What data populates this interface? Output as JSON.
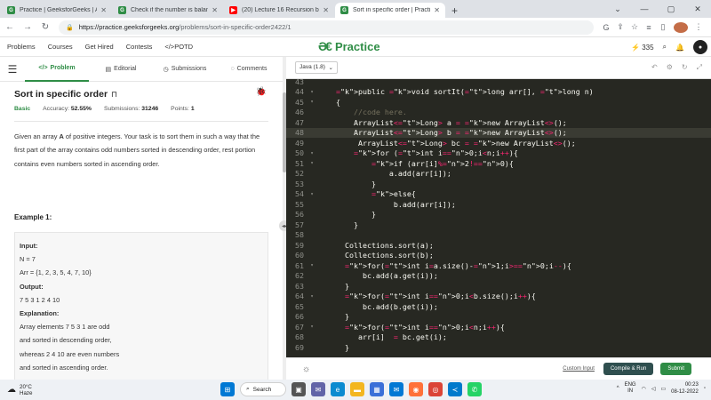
{
  "browser": {
    "tabs": [
      {
        "title": "Practice | GeeksforGeeks | A com",
        "color": "#2f8d46",
        "active": false
      },
      {
        "title": "Check if the number is balanced",
        "color": "#2f8d46",
        "active": false
      },
      {
        "title": "(20) Lecture 16 Recursion basics",
        "color": "#ff0000",
        "active": false
      },
      {
        "title": "Sort in specific order | Practice |",
        "color": "#2f8d46",
        "active": true
      }
    ],
    "new_tab": "+",
    "url_host": "https://practice.geeksforgeeks.org",
    "url_path": "/problems/sort-in-specific-order2422/1"
  },
  "header": {
    "nav": [
      "Problems",
      "Courses",
      "Get Hired",
      "Contests",
      "POTD"
    ],
    "logo_text": "Practice",
    "streak": "335"
  },
  "left_tabs": [
    "Problem",
    "Editorial",
    "Submissions",
    "Comments"
  ],
  "problem": {
    "title": "Sort in specific order",
    "difficulty": "Basic",
    "accuracy_label": "Accuracy:",
    "accuracy": "52.55%",
    "submissions_label": "Submissions:",
    "submissions": "31246",
    "points_label": "Points:",
    "points": "1",
    "desc_pre": "Given an array ",
    "desc_bold": "A",
    "desc_post": " of positive integers. Your task is to sort them in such a way that the first part of the array contains odd numbers sorted in descending order, rest portion contains even numbers sorted in ascending order.",
    "example_title": "Example 1:",
    "input_label": "Input:",
    "input_n": "N = 7",
    "input_arr": "Arr = {1, 2, 3, 5, 4, 7, 10}",
    "output_label": "Output:",
    "output_val": "7 5 3 1 2 4 10",
    "explanation_label": "Explanation:",
    "explanation_lines": [
      "Array elements 7 5 3 1 are odd",
      "and sorted in descending order,",
      "whereas 2 4 10 are even numbers",
      "and sorted in ascending order."
    ]
  },
  "editor": {
    "language": "Java (1.8)",
    "custom_input": "Custom Input",
    "compile_run": "Compile & Run",
    "submit": "Submit",
    "first_line": 43,
    "highlight_line": 48,
    "lines": [
      "",
      "    public void sortIt(long arr[], long n)",
      "    {",
      "        //code here.",
      "        ArrayList<Long> a = new ArrayList<>();",
      "        ArrayList<Long> b = new ArrayList<>();",
      "         ArrayList<Long> bc = new ArrayList<>();",
      "        for (int i=0;i<n;i++){",
      "            if (arr[i]%2!=0){",
      "                a.add(arr[i]);",
      "            }",
      "            else{",
      "                 b.add(arr[i]);",
      "            }",
      "        }",
      "",
      "      Collections.sort(a);",
      "      Collections.sort(b);",
      "      for(int i=a.size()-1;i>=0;i--){",
      "          bc.add(a.get(i));",
      "      }",
      "      for(int i=0;i<b.size();i++){",
      "          bc.add(b.get(i));",
      "      }",
      "      for(int i=0;i<n;i++){",
      "         arr[i]  = bc.get(i);",
      "      }"
    ]
  },
  "taskbar": {
    "temp": "20°C",
    "weather": "Haze",
    "search": "Search",
    "lang1": "ENG",
    "lang2": "IN",
    "time": "00:23",
    "date": "08-12-2022"
  }
}
